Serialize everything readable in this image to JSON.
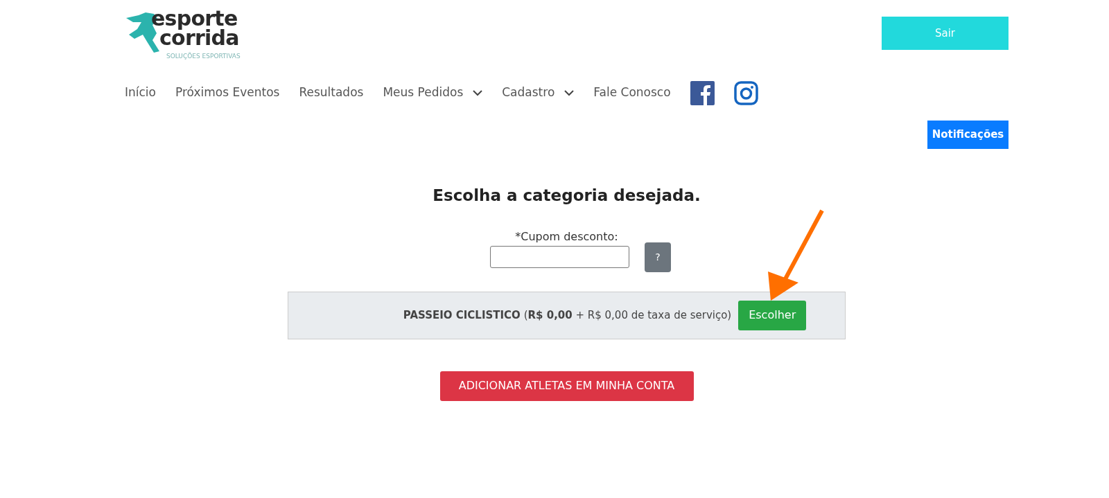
{
  "header": {
    "logo": {
      "line1": "esporte",
      "line2": "corrida",
      "tagline": "SOLUÇÕES ESPORTIVAS"
    },
    "logout_button": "Sair"
  },
  "nav": [
    {
      "label": "Início",
      "dropdown": false
    },
    {
      "label": "Próximos Eventos",
      "dropdown": false
    },
    {
      "label": "Resultados",
      "dropdown": false
    },
    {
      "label": "Meus Pedidos",
      "dropdown": true
    },
    {
      "label": "Cadastro",
      "dropdown": true
    },
    {
      "label": "Fale Conosco",
      "dropdown": false
    }
  ],
  "notifications_button": "Notificações",
  "title": "Escolha a categoria desejada.",
  "coupon": {
    "label": "*Cupom desconto:",
    "help_button": "?"
  },
  "categories": [
    {
      "text": "**PASSEIO CICLISTICO** (**R$ 0,00** + R$ 0,00 de taxa de serviço)",
      "button": "Escolher"
    }
  ],
  "add_athletes_button": "ADICIONAR ATLETAS EM MINHA CONTA"
}
